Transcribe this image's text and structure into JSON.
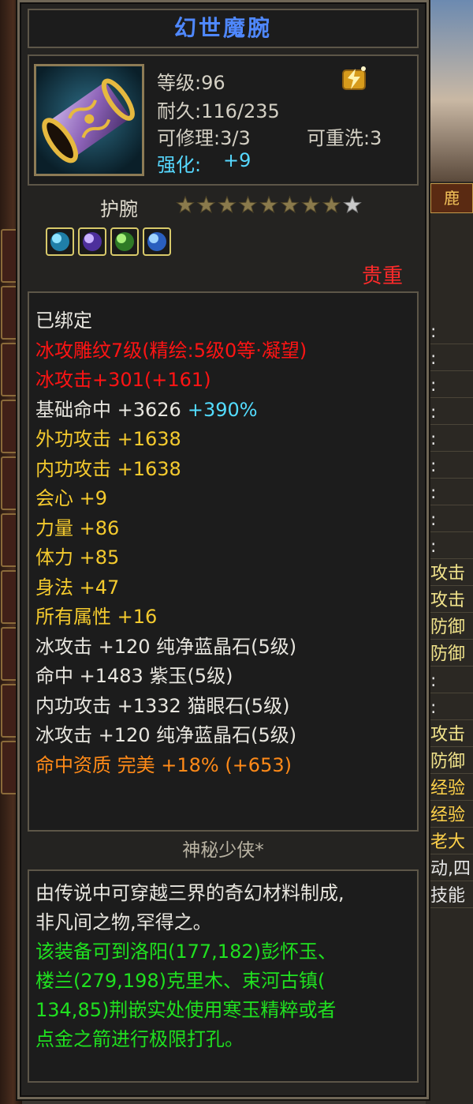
{
  "item": {
    "name": "幻世魔腕",
    "icon": "purple-wrist-guard-icon",
    "quality_icon": "gold-sparkle-icon",
    "level_label": "等级:96",
    "durability_label": "耐久:116/235",
    "repair_label": "可修理:3/3",
    "rewash_label": "可重洗:3",
    "enhance_label": "强化:",
    "enhance_value": "+9",
    "type": "护腕",
    "stars_filled": 8,
    "stars_total": 9,
    "rarity": "贵重",
    "gems": [
      "light-blue-gem-icon",
      "purple-gem-icon",
      "green-gem-icon",
      "blue-gem-icon"
    ]
  },
  "attributes": [
    {
      "text": "已绑定",
      "color": "white"
    },
    {
      "text": "冰攻雕纹7级(精绘:5级0等·凝望)",
      "color": "red"
    },
    {
      "text": "冰攻击+301(+161)",
      "color": "red"
    },
    {
      "text": "基础命中 +3626",
      "extra": "+390%",
      "color": "white"
    },
    {
      "text": "外功攻击 +1638",
      "color": "yellow"
    },
    {
      "text": "内功攻击 +1638",
      "color": "yellow"
    },
    {
      "text": "会心 +9",
      "color": "yellow"
    },
    {
      "text": "力量 +86",
      "color": "yellow"
    },
    {
      "text": "体力 +85",
      "color": "yellow"
    },
    {
      "text": "身法 +47",
      "color": "yellow"
    },
    {
      "text": "所有属性 +16",
      "color": "yellow"
    },
    {
      "text": "冰攻击 +120 纯净蓝晶石(5级)",
      "color": "white"
    },
    {
      "text": "命中 +1483 紫玉(5级)",
      "color": "white"
    },
    {
      "text": "内功攻击 +1332 猫眼石(5级)",
      "color": "white"
    },
    {
      "text": "冰攻击 +120 纯净蓝晶石(5级)",
      "color": "white"
    },
    {
      "text": "命中资质  完美 +18% (+653)",
      "color": "orange"
    }
  ],
  "maker": "神秘少侠*",
  "description": {
    "lines_white": [
      "由传说中可穿越三界的奇幻材料制成,",
      "非凡间之物,罕得之。"
    ],
    "lines_green": [
      "该装备可到洛阳(177,182)彭怀玉、",
      "楼兰(279,198)克里木、束河古镇(",
      "134,85)荆嵌实处使用寒玉精粹或者",
      "点金之箭进行极限打孔。"
    ]
  },
  "background": {
    "tab_label": "鹿",
    "rows": [
      {
        "text": ":",
        "style": "white"
      },
      {
        "text": ":",
        "style": "white"
      },
      {
        "text": ":",
        "style": "white"
      },
      {
        "text": ":",
        "style": "white"
      },
      {
        "text": ":",
        "style": "white"
      },
      {
        "text": ":",
        "style": "white"
      },
      {
        "text": ":",
        "style": "white"
      },
      {
        "text": ":",
        "style": "white"
      },
      {
        "text": ":",
        "style": "white"
      },
      {
        "text": "攻击",
        "style": "yellow"
      },
      {
        "text": "攻击",
        "style": "yellow"
      },
      {
        "text": "防御",
        "style": "yellow"
      },
      {
        "text": "防御",
        "style": "yellow"
      },
      {
        "text": ":",
        "style": "white"
      },
      {
        "text": ":",
        "style": "white"
      },
      {
        "text": "攻击",
        "style": "yellow"
      },
      {
        "text": "防御",
        "style": "yellow"
      },
      {
        "text": "经验",
        "style": "gold"
      },
      {
        "text": "经验",
        "style": "gold"
      },
      {
        "text": "老大",
        "style": "gold"
      },
      {
        "text": "动,四",
        "style": "white"
      },
      {
        "text": "技能",
        "style": "white"
      }
    ]
  }
}
